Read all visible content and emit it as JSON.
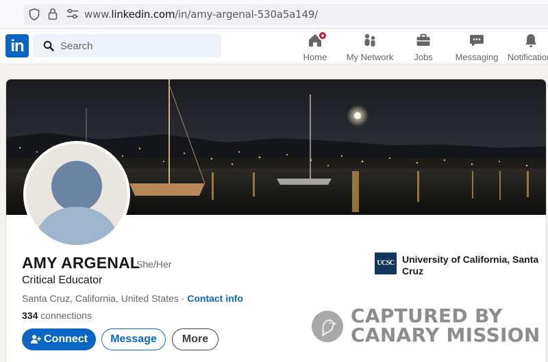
{
  "browser": {
    "url_prefix": "www.",
    "url_domain": "linkedin.com",
    "url_path": "/in/amy-argenal-530a5a149/"
  },
  "nav": {
    "logo": "in",
    "search_placeholder": "Search",
    "items": [
      {
        "label": "Home",
        "icon": "home-icon"
      },
      {
        "label": "My Network",
        "icon": "network-icon"
      },
      {
        "label": "Jobs",
        "icon": "briefcase-icon"
      },
      {
        "label": "Messaging",
        "icon": "chat-icon"
      },
      {
        "label": "Notifications",
        "icon": "bell-icon"
      }
    ]
  },
  "profile": {
    "name": "AMY ARGENAL",
    "pronouns": "She/Her",
    "headline": "Critical Educator",
    "location": "Santa Cruz, California, United States",
    "separator": " · ",
    "contact_info": "Contact info",
    "connections_count": "334",
    "connections_label": " connections"
  },
  "actions": {
    "connect": "Connect",
    "message": "Message",
    "more": "More"
  },
  "education": {
    "logo_text": "UCSC",
    "school": "University of California, Santa Cruz"
  },
  "watermark": {
    "line1": "CAPTURED BY",
    "line2": "CANARY MISSION"
  },
  "colors": {
    "linkedin_blue": "#0a66c2",
    "notification_red": "#cb112d",
    "ucsc_navy": "#13365f"
  }
}
